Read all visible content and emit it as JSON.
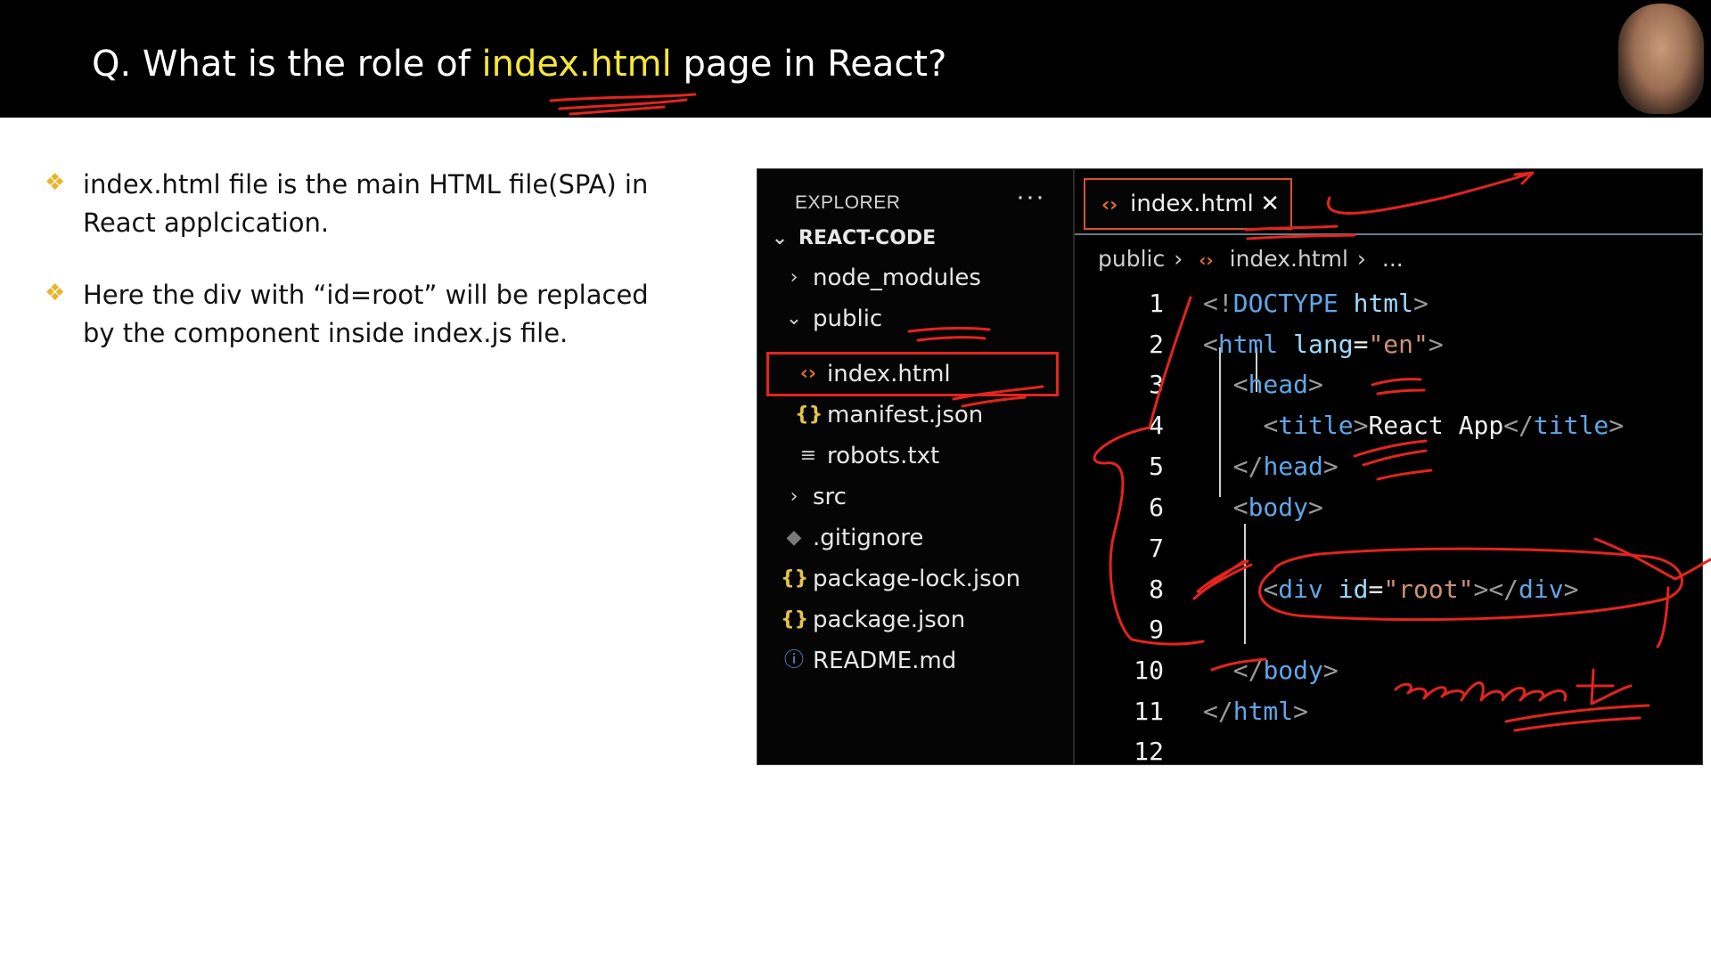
{
  "header": {
    "title_pre": "Q. What is the role of ",
    "title_highlight": "index.html",
    "title_post": " page in React?"
  },
  "bullets": [
    {
      "line1": "index.html file is the main HTML file(SPA) in",
      "line2": "React applcication."
    },
    {
      "line1": "Here the div with “id=root” will be replaced",
      "line2": "by the component inside index.js file."
    }
  ],
  "explorer": {
    "title": "EXPLORER",
    "more": "···",
    "root": "REACT-CODE",
    "items": [
      {
        "label": "node_modules",
        "icon": "chevron-right-icon"
      },
      {
        "label": "public",
        "icon": "chevron-down-icon"
      },
      {
        "label": "index.html",
        "icon": "html-icon"
      },
      {
        "label": "manifest.json",
        "icon": "json-icon"
      },
      {
        "label": "robots.txt",
        "icon": "text-file-icon"
      },
      {
        "label": "src",
        "icon": "chevron-right-icon"
      },
      {
        "label": ".gitignore",
        "icon": "git-icon"
      },
      {
        "label": "package-lock.json",
        "icon": "json-icon"
      },
      {
        "label": "package.json",
        "icon": "json-icon"
      },
      {
        "label": "README.md",
        "icon": "info-icon"
      }
    ]
  },
  "tab": {
    "label": "index.html",
    "close": "✕"
  },
  "breadcrumb": {
    "part1": "public",
    "part2": "index.html",
    "part3": "..."
  },
  "code": {
    "line_numbers": [
      "1",
      "2",
      "3",
      "4",
      "5",
      "6",
      "7",
      "8",
      "9",
      "10",
      "11",
      "12"
    ],
    "l1": {
      "a": "<!",
      "b": "DOCTYPE",
      "c": " html",
      "d": ">"
    },
    "l2": {
      "a": "<",
      "b": "html",
      "c": " lang",
      "d": "=",
      "e": "\"en\"",
      "f": ">"
    },
    "l3": {
      "a": "<",
      "b": "head",
      "c": ">"
    },
    "l4": {
      "a": "<",
      "b": "title",
      "c": ">",
      "d": "React App",
      "e": "</",
      "f": "title",
      "g": ">"
    },
    "l5": {
      "a": "</",
      "b": "head",
      "c": ">"
    },
    "l6": {
      "a": "<",
      "b": "body",
      "c": ">"
    },
    "l8": {
      "a": "<",
      "b": "div",
      "c": " id",
      "d": "=",
      "e": "\"root\"",
      "f": "></",
      "g": "div",
      "h": ">"
    },
    "l10": {
      "a": "</",
      "b": "body",
      "c": ">"
    },
    "l11": {
      "a": "</",
      "b": "html",
      "c": ">"
    }
  },
  "colors": {
    "highlight": "#f4e73a",
    "annotation": "#e4241e",
    "html_icon": "#e06c3c",
    "json_icon": "#e3c44b"
  }
}
